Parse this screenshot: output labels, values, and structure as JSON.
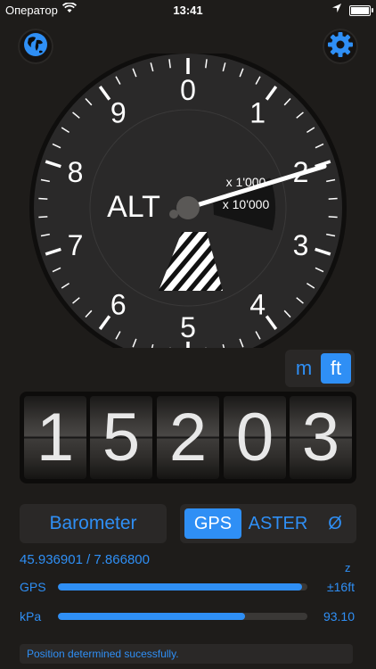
{
  "status_bar": {
    "carrier": "Оператор",
    "time": "13:41"
  },
  "colors": {
    "accent": "#2f8ff5",
    "background": "#1e1c1a",
    "dial_face": "#2a2929"
  },
  "gauge": {
    "label": "ALT",
    "scale_labels": [
      "0",
      "1",
      "2",
      "3",
      "4",
      "5",
      "6",
      "7",
      "8",
      "9"
    ],
    "window_text_top": "x 1'000",
    "window_text_bottom": "x 10'000",
    "needle_value": 15203
  },
  "unit_toggle": {
    "options": [
      "m",
      "ft"
    ],
    "selected": "ft"
  },
  "counter": {
    "digits": [
      "1",
      "5",
      "2",
      "0",
      "3"
    ]
  },
  "barometer_button": "Barometer",
  "source_segment": {
    "options": [
      "GPS",
      "ASTER",
      "Ø"
    ],
    "selected": "GPS"
  },
  "coordinates": "45.936901 / 7.866800",
  "z_label": "z",
  "bars": [
    {
      "label": "GPS",
      "value_text": "±16ft",
      "fill_fraction": 0.98
    },
    {
      "label": "kPa",
      "value_text": "93.10",
      "fill_fraction": 0.75
    }
  ],
  "status_message": "Position determined sucessfully."
}
